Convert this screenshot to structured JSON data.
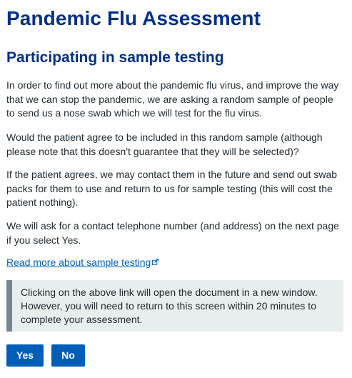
{
  "page": {
    "title": "Pandemic Flu Assessment",
    "section_title": "Participating in sample testing",
    "paragraphs": [
      "In order to find out more about the pandemic flu virus, and improve the way that we can stop the pandemic, we are asking a random sample of people to send us a nose swab which we will test for the flu virus.",
      "Would the patient agree to be included in this random sample (although please note that this doesn't guarantee that they will be selected)?",
      "If the patient agrees, we may contact them in the future and send out swab packs for them to use and return to us for sample testing (this will cost the patient nothing).",
      "We will ask for a contact telephone number (and address) on the next page if you select Yes."
    ],
    "link": {
      "label": "Read more about sample testing",
      "icon": "external-link-icon"
    },
    "callout": {
      "text": "Clicking on the above link will open the document in a new window. However, you will need to return to this screen within 20 minutes to complete your assessment."
    },
    "buttons": {
      "yes_label": "Yes",
      "no_label": "No"
    }
  },
  "colors": {
    "heading": "#003087",
    "body_text": "#212b32",
    "link": "#005eb8",
    "button_bg": "#005eb8",
    "button_text": "#ffffff",
    "callout_bg": "#e8edee",
    "callout_border": "#768692"
  }
}
